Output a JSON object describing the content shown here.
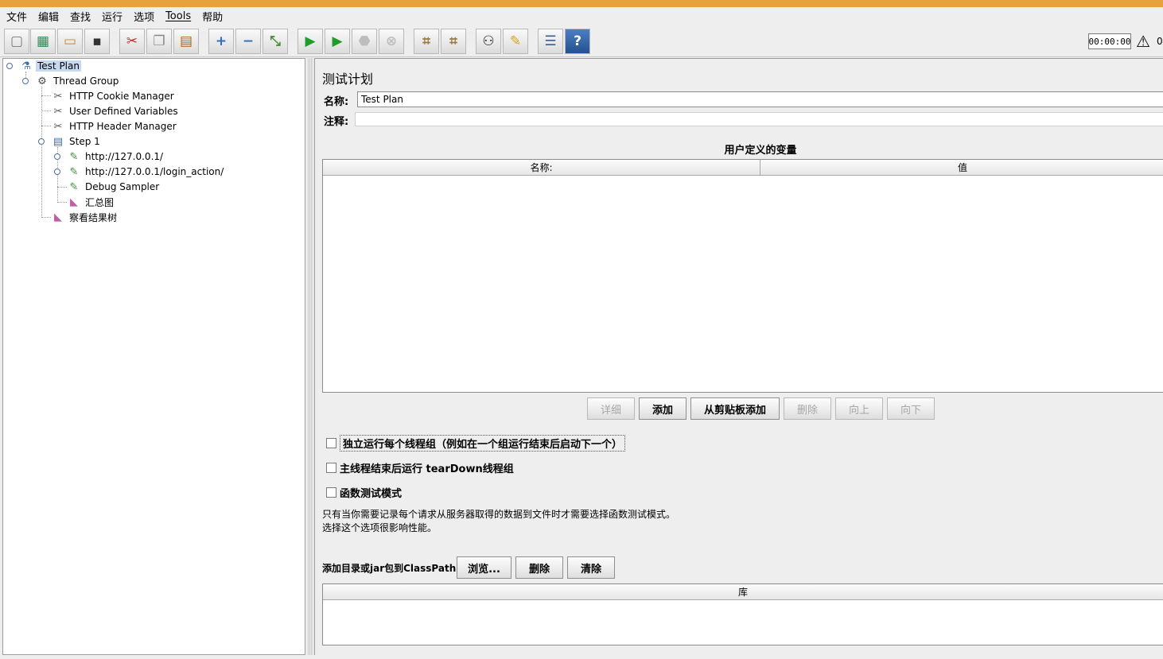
{
  "menu": [
    "文件",
    "编辑",
    "查找",
    "运行",
    "选项",
    "Tools",
    "帮助"
  ],
  "toolbar": {
    "timer": "00:00:00",
    "warning_count": "0",
    "icons": [
      {
        "name": "new-icon",
        "glyph": "▢"
      },
      {
        "name": "templates-icon",
        "glyph": "▦"
      },
      {
        "name": "open-icon",
        "glyph": "▭"
      },
      {
        "name": "save-icon",
        "glyph": "▪"
      },
      {
        "name": "cut-icon",
        "glyph": "✂"
      },
      {
        "name": "copy-icon",
        "glyph": "❐"
      },
      {
        "name": "paste-icon",
        "glyph": "▤"
      },
      {
        "name": "expand-icon",
        "glyph": "+"
      },
      {
        "name": "collapse-icon",
        "glyph": "−"
      },
      {
        "name": "toggle-icon",
        "glyph": "⤡"
      },
      {
        "name": "start-icon",
        "glyph": "▶"
      },
      {
        "name": "start-no-pauses-icon",
        "glyph": "▶"
      },
      {
        "name": "stop-icon",
        "glyph": "⬣"
      },
      {
        "name": "shutdown-icon",
        "glyph": "⊗"
      },
      {
        "name": "clear-icon",
        "glyph": "⌗"
      },
      {
        "name": "clear-all-icon",
        "glyph": "⌗"
      },
      {
        "name": "search-icon",
        "glyph": "⚇"
      },
      {
        "name": "reset-search-icon",
        "glyph": "✎"
      },
      {
        "name": "function-helper-icon",
        "glyph": "☰"
      },
      {
        "name": "help-icon",
        "glyph": "?"
      }
    ]
  },
  "tree": [
    {
      "label": "Test Plan",
      "icon": "test-plan-icon",
      "glyph": "⚗",
      "selected": true
    },
    {
      "label": "Thread Group",
      "icon": "thread-group-icon",
      "glyph": "⚙"
    },
    {
      "label": "HTTP Cookie Manager",
      "icon": "config-element-icon",
      "glyph": "✂"
    },
    {
      "label": "User Defined Variables",
      "icon": "config-element-icon",
      "glyph": "✂"
    },
    {
      "label": "HTTP Header Manager",
      "icon": "config-element-icon",
      "glyph": "✂"
    },
    {
      "label": "Step 1",
      "icon": "controller-icon",
      "glyph": "▤"
    },
    {
      "label": "http://127.0.0.1/",
      "icon": "sampler-icon",
      "glyph": "✎"
    },
    {
      "label": "http://127.0.0.1/login_action/",
      "icon": "sampler-icon",
      "glyph": "✎"
    },
    {
      "label": "Debug Sampler",
      "icon": "sampler-icon",
      "glyph": "✎"
    },
    {
      "label": "汇总图",
      "icon": "listener-icon",
      "glyph": "◣"
    },
    {
      "label": "察看结果树",
      "icon": "listener-icon",
      "glyph": "◣"
    }
  ],
  "panel": {
    "heading": "测试计划",
    "name_label": "名称:",
    "name_value": "Test Plan",
    "comment_label": "注释:",
    "comment_value": "",
    "variables_title": "用户定义的变量",
    "col_name": "名称:",
    "col_value": "值",
    "buttons": {
      "detail": "详细",
      "add": "添加",
      "add_clipboard": "从剪贴板添加",
      "delete": "删除",
      "up": "向上",
      "down": "向下"
    },
    "checkbox_serial": "独立运行每个线程组（例如在一个组运行结束后启动下一个）",
    "checkbox_teardown": "主线程结束后运行 tearDown线程组",
    "checkbox_functional": "函数测试模式",
    "note_line1": "只有当你需要记录每个请求从服务器取得的数据到文件时才需要选择函数测试模式。",
    "note_line2": "选择这个选项很影响性能。",
    "classpath_label": "添加目录或jar包到ClassPath",
    "classpath_browse": "浏览...",
    "classpath_delete": "删除",
    "classpath_clear": "清除",
    "library_header": "库"
  }
}
